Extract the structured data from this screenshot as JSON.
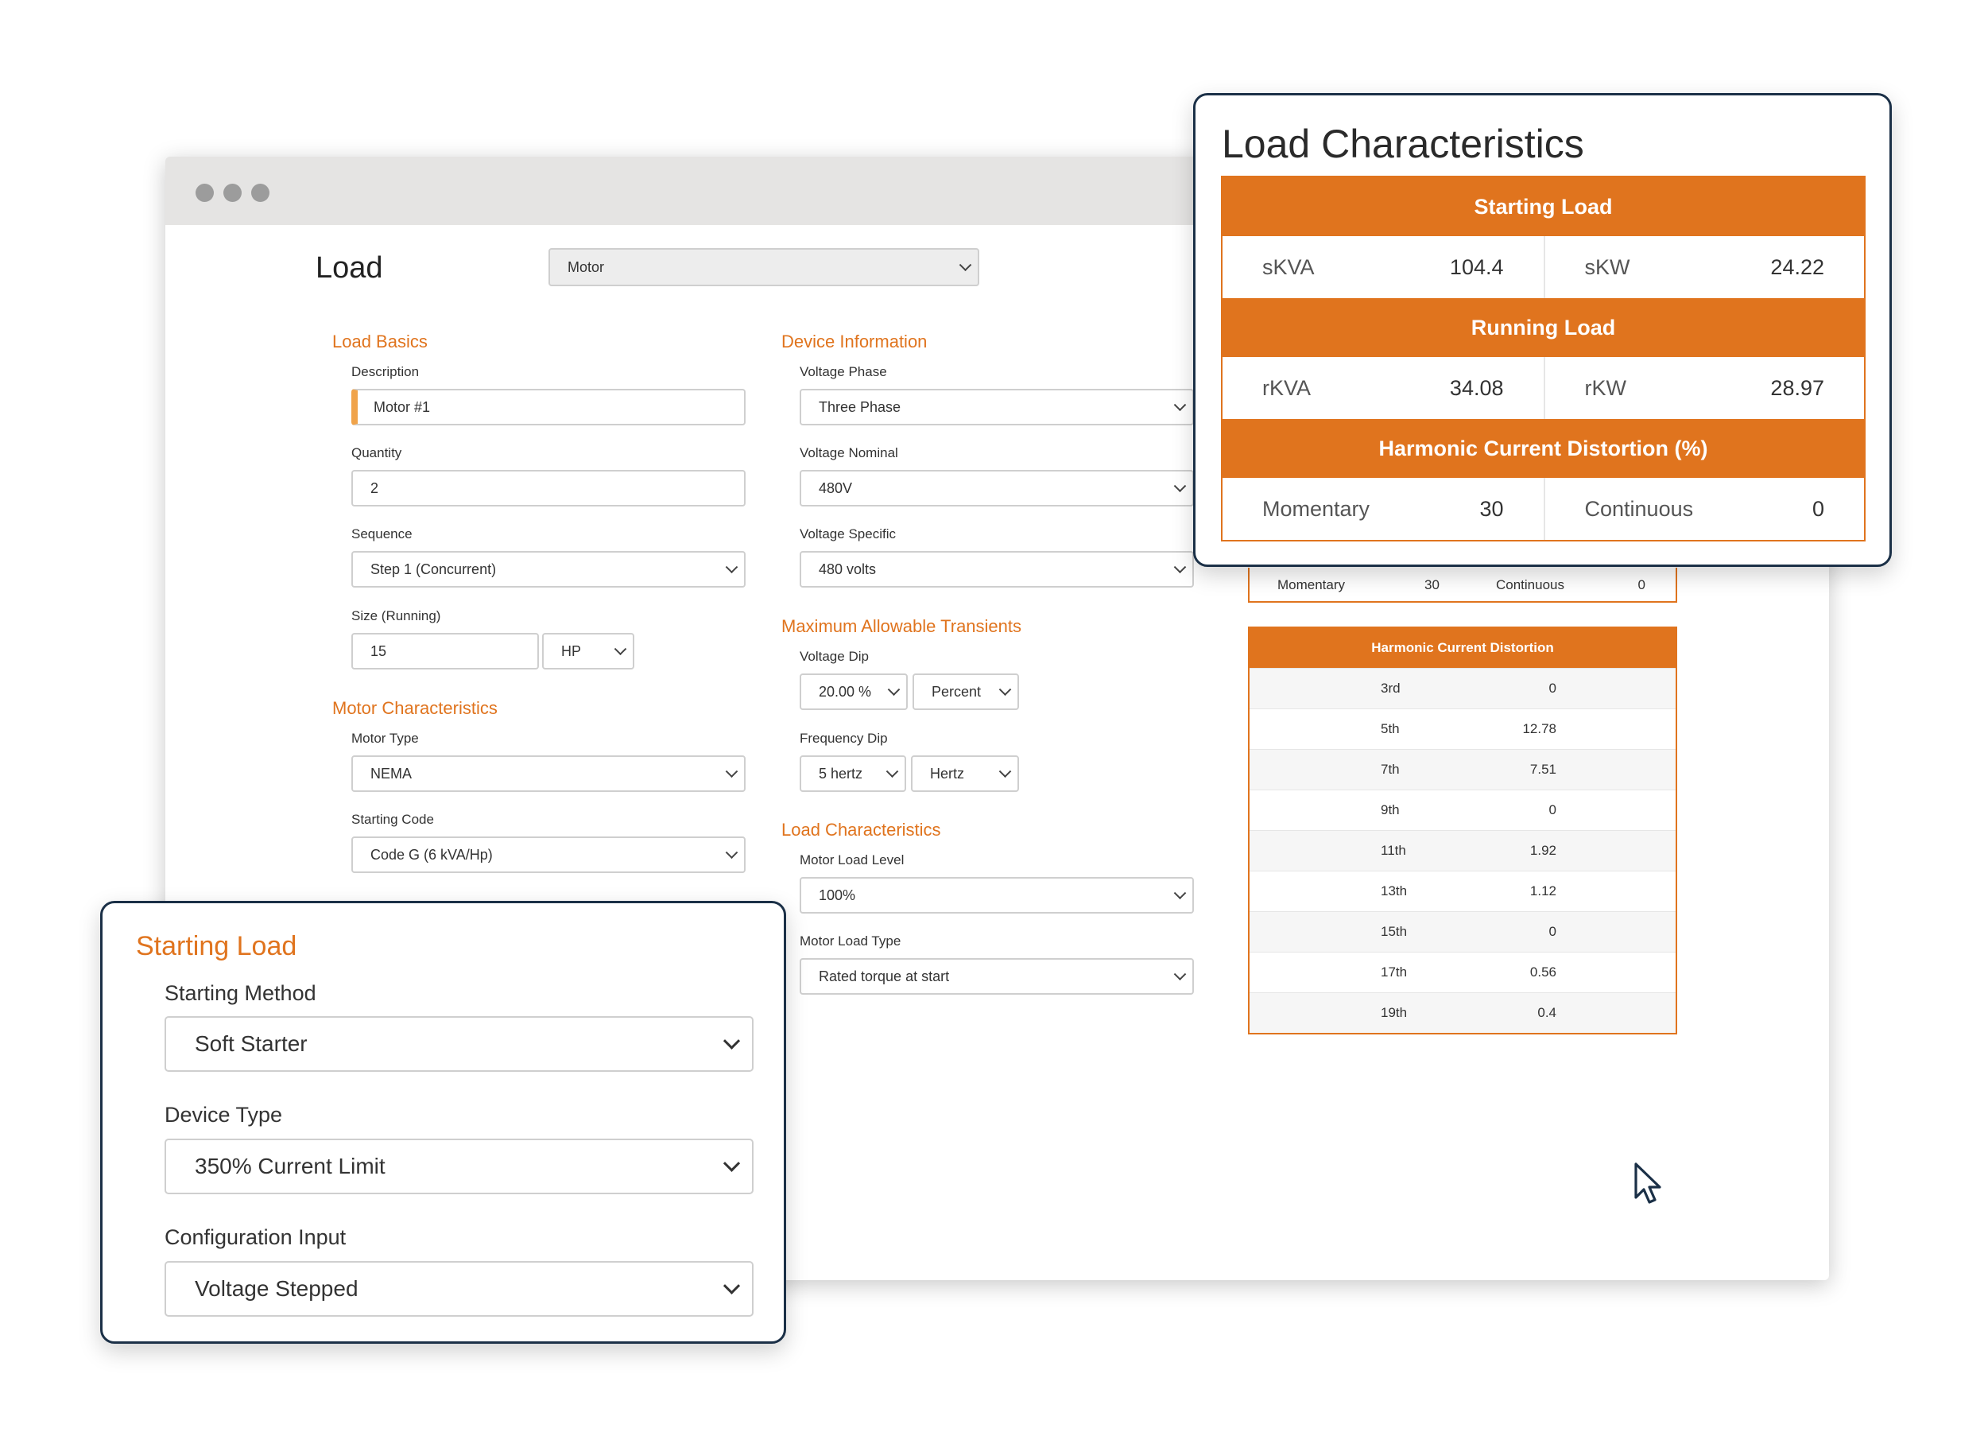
{
  "page_title": "Load",
  "load_type": "Motor",
  "sections": {
    "load_basics": "Load Basics",
    "device_information": "Device Information",
    "motor_characteristics": "Motor Characteristics",
    "max_transients": "Maximum Allowable Transients",
    "load_characteristics": "Load Characteristics"
  },
  "fields": {
    "description": {
      "label": "Description",
      "value": "Motor #1"
    },
    "quantity": {
      "label": "Quantity",
      "value": "2"
    },
    "sequence": {
      "label": "Sequence",
      "value": "Step 1 (Concurrent)"
    },
    "size_running": {
      "label": "Size (Running)",
      "value": "15",
      "unit": "HP"
    },
    "motor_type": {
      "label": "Motor Type",
      "value": "NEMA"
    },
    "starting_code": {
      "label": "Starting Code",
      "value": "Code G (6 kVA/Hp)"
    },
    "voltage_phase": {
      "label": "Voltage Phase",
      "value": "Three Phase"
    },
    "voltage_nominal": {
      "label": "Voltage Nominal",
      "value": "480V"
    },
    "voltage_specific": {
      "label": "Voltage Specific",
      "value": "480 volts"
    },
    "voltage_dip": {
      "label": "Voltage Dip",
      "value": "20.00 %",
      "unit": "Percent"
    },
    "frequency_dip": {
      "label": "Frequency Dip",
      "value": "5 hertz",
      "unit": "Hertz"
    },
    "motor_load_level": {
      "label": "Motor Load Level",
      "value": "100%"
    },
    "motor_load_type": {
      "label": "Motor Load Type",
      "value": "Rated torque at start"
    }
  },
  "mini_hcd_row": {
    "momentary_label": "Momentary",
    "momentary_value": "30",
    "continuous_label": "Continuous",
    "continuous_value": "0"
  },
  "harmonic_table": {
    "title": "Harmonic Current Distortion",
    "rows": [
      {
        "k": "3rd",
        "v": "0"
      },
      {
        "k": "5th",
        "v": "12.78"
      },
      {
        "k": "7th",
        "v": "7.51"
      },
      {
        "k": "9th",
        "v": "0"
      },
      {
        "k": "11th",
        "v": "1.92"
      },
      {
        "k": "13th",
        "v": "1.12"
      },
      {
        "k": "15th",
        "v": "0"
      },
      {
        "k": "17th",
        "v": "0.56"
      },
      {
        "k": "19th",
        "v": "0.4"
      }
    ]
  },
  "load_characteristics_card": {
    "title": "Load Characteristics",
    "starting_load": "Starting Load",
    "skva_label": "sKVA",
    "skva": "104.4",
    "skw_label": "sKW",
    "skw": "24.22",
    "running_load": "Running Load",
    "rkva_label": "rKVA",
    "rkva": "34.08",
    "rkw_label": "rKW",
    "rkw": "28.97",
    "hcd": "Harmonic Current Distortion (%)",
    "momentary_label": "Momentary",
    "momentary": "30",
    "continuous_label": "Continuous",
    "continuous": "0"
  },
  "starting_load_card": {
    "title": "Starting Load",
    "starting_method_label": "Starting Method",
    "starting_method": "Soft Starter",
    "device_type_label": "Device Type",
    "device_type": "350% Current Limit",
    "configuration_input_label": "Configuration Input",
    "configuration_input": "Voltage Stepped"
  },
  "colors": {
    "accent": "#e0741e",
    "card_border": "#1b3047",
    "field_accent": "#f0a34a"
  }
}
